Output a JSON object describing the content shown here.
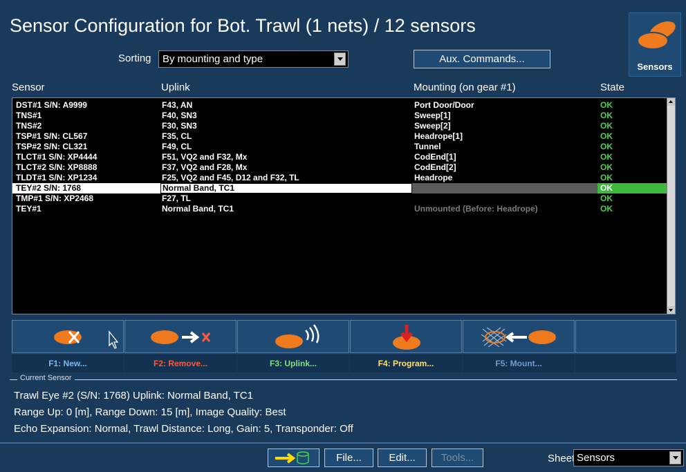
{
  "window": {
    "title": "Sensor Configuration for Bot. Trawl (1 nets) / 12 sensors"
  },
  "badge": {
    "label": "Sensors",
    "icon": "sensor-icon"
  },
  "sorting": {
    "label": "Sorting",
    "value": "By mounting and type"
  },
  "aux_commands": {
    "label": "Aux. Commands..."
  },
  "columns": {
    "sensor": "Sensor",
    "uplink": "Uplink",
    "mounting": "Mounting (on gear #1)",
    "state": "State"
  },
  "rows": [
    {
      "sensor": "DST#1 S/N: A9999",
      "uplink": "F43, AN",
      "mounting": "Port Door/Door",
      "state": "OK"
    },
    {
      "sensor": "TNS#1",
      "uplink": "F40, SN3",
      "mounting": "Sweep[1]",
      "state": "OK"
    },
    {
      "sensor": "TNS#2",
      "uplink": "F30, SN3",
      "mounting": "Sweep[2]",
      "state": "OK"
    },
    {
      "sensor": "TSP#1 S/N: CL567",
      "uplink": "F35, CL",
      "mounting": "Headrope[1]",
      "state": "OK"
    },
    {
      "sensor": "TSP#2 S/N: CL321",
      "uplink": "F49, CL",
      "mounting": "Tunnel",
      "state": "OK"
    },
    {
      "sensor": "TLCT#1 S/N: XP4444",
      "uplink": "F51, VQ2 and F32, Mx",
      "mounting": "CodEnd[1]",
      "state": "OK"
    },
    {
      "sensor": "TLCT#2 S/N: XP8888",
      "uplink": "F37, VQ2 and F28, Mx",
      "mounting": "CodEnd[2]",
      "state": "OK"
    },
    {
      "sensor": "TLDT#1 S/N: XP1234",
      "uplink": "F25, VQ2 and F45, D12 and F32, TL",
      "mounting": "Headrope",
      "state": "OK"
    },
    {
      "sensor": "TEY#2 S/N: 1768",
      "uplink": "Normal Band, TC1",
      "mounting": "",
      "state": "OK"
    },
    {
      "sensor": "TMP#1 S/N: XP2468",
      "uplink": "F27, TL",
      "mounting": "",
      "state": "OK"
    },
    {
      "sensor": "TEY#1",
      "uplink": "Normal Band, TC1",
      "mounting": "Unmounted (Before: Headrope)",
      "state": "OK"
    }
  ],
  "function_keys": [
    {
      "label": "F1: New...",
      "color": "#7fb8e8",
      "icon": "new-sensor-icon"
    },
    {
      "label": "F2: Remove...",
      "color": "#ff5a3c",
      "icon": "remove-sensor-icon"
    },
    {
      "label": "F3: Uplink...",
      "color": "#7fe07f",
      "icon": "uplink-icon"
    },
    {
      "label": "F4: Program...",
      "color": "#ffe066",
      "icon": "program-icon"
    },
    {
      "label": "F5: Mount...",
      "color": "#6f9ccc",
      "icon": "mount-icon"
    },
    {
      "label": "",
      "color": "#ffffff",
      "icon": ""
    }
  ],
  "current_sensor": {
    "legend": "Current Sensor",
    "line1": "Trawl Eye #2 (S/N: 1768)  Uplink: Normal Band, TC1",
    "line2": "Range Up: 0 [m], Range Down: 15 [m], Image Quality: Best",
    "line3": "Echo Expansion: Normal, Trawl Distance: Long, Gain: 5, Transponder: Off"
  },
  "bottom": {
    "file": "File...",
    "edit": "Edit...",
    "tools": "Tools...",
    "sheet_label": "Sheet",
    "sheet_value": "Sensors"
  },
  "colors": {
    "background": "#1a3a5c",
    "ok_green": "#4cd14c",
    "sensor_orange": "#f07a1e"
  }
}
